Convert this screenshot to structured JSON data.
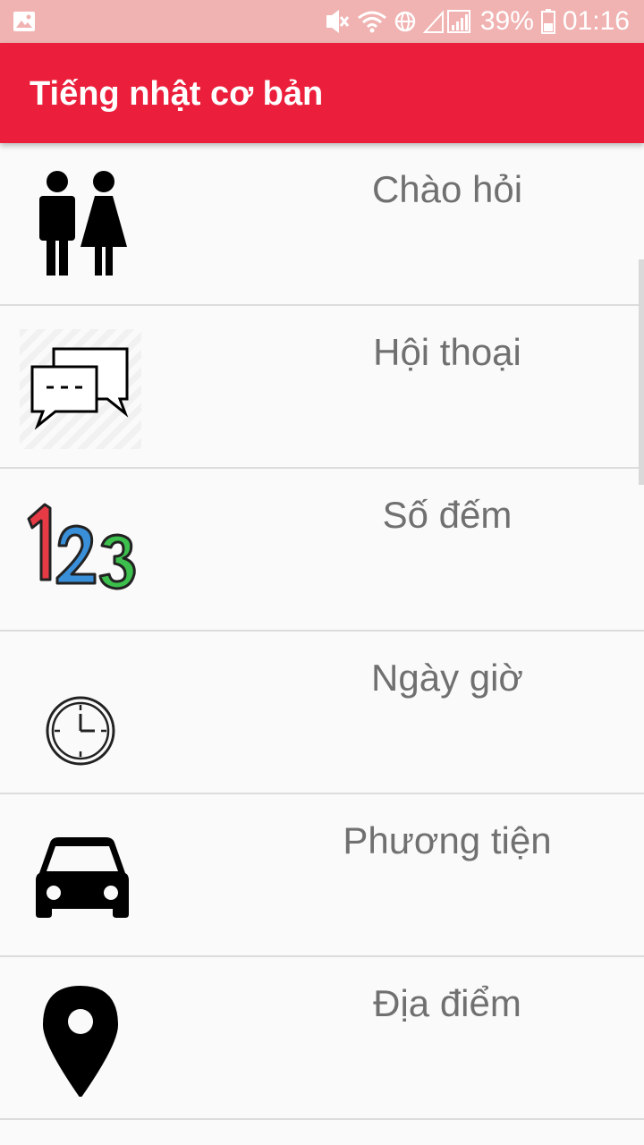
{
  "status_bar": {
    "battery_percent": "39%",
    "time": "01:16",
    "icons": [
      "image-notification-icon",
      "mute-icon",
      "wifi-icon",
      "signal-icon",
      "battery-icon"
    ]
  },
  "app_bar": {
    "title": "Tiếng nhật cơ bản",
    "color": "#eb1f3b"
  },
  "menu": {
    "items": [
      {
        "label": "Chào hỏi",
        "icon": "people-icon"
      },
      {
        "label": "Hội thoại",
        "icon": "conversation-icon"
      },
      {
        "label": "Số đếm",
        "icon": "numbers-123-icon"
      },
      {
        "label": "Ngày giờ",
        "icon": "clock-icon"
      },
      {
        "label": "Phương tiện",
        "icon": "car-icon"
      },
      {
        "label": "Địa điểm",
        "icon": "location-pin-icon"
      }
    ]
  }
}
